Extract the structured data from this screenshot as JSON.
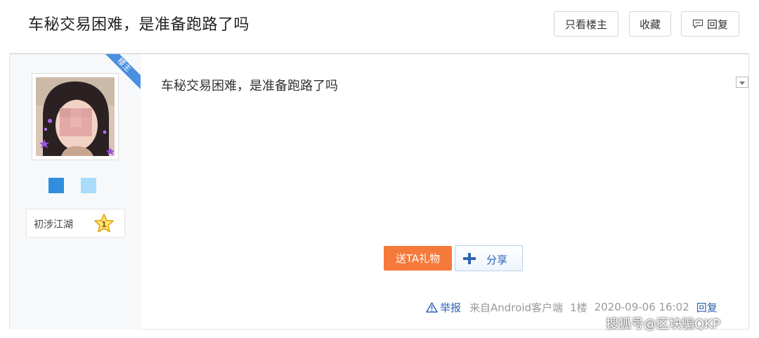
{
  "header": {
    "title": "车秘交易困难，是准备跑路了吗",
    "only_author": "只看楼主",
    "favorite": "收藏",
    "reply": "回复"
  },
  "author": {
    "badge": "楼主",
    "level_name": "初涉江湖",
    "level_num": "1",
    "level_colors": [
      "#2f8fdd",
      "#a9dcfb"
    ]
  },
  "post": {
    "content": "车秘交易困难，是准备跑路了吗",
    "gift_button": "送TA礼物",
    "share_button": "分享"
  },
  "meta": {
    "report": "举报",
    "source": "来自Android客户端",
    "floor": "1楼",
    "time": "2020-09-06 16:02",
    "reply": "回复"
  },
  "watermark": "搜狐号@区块骗QKP",
  "colors": {
    "accent_blue": "#2d64b3",
    "gift_orange": "#f5793a",
    "badge_blue": "#4a90e2"
  }
}
